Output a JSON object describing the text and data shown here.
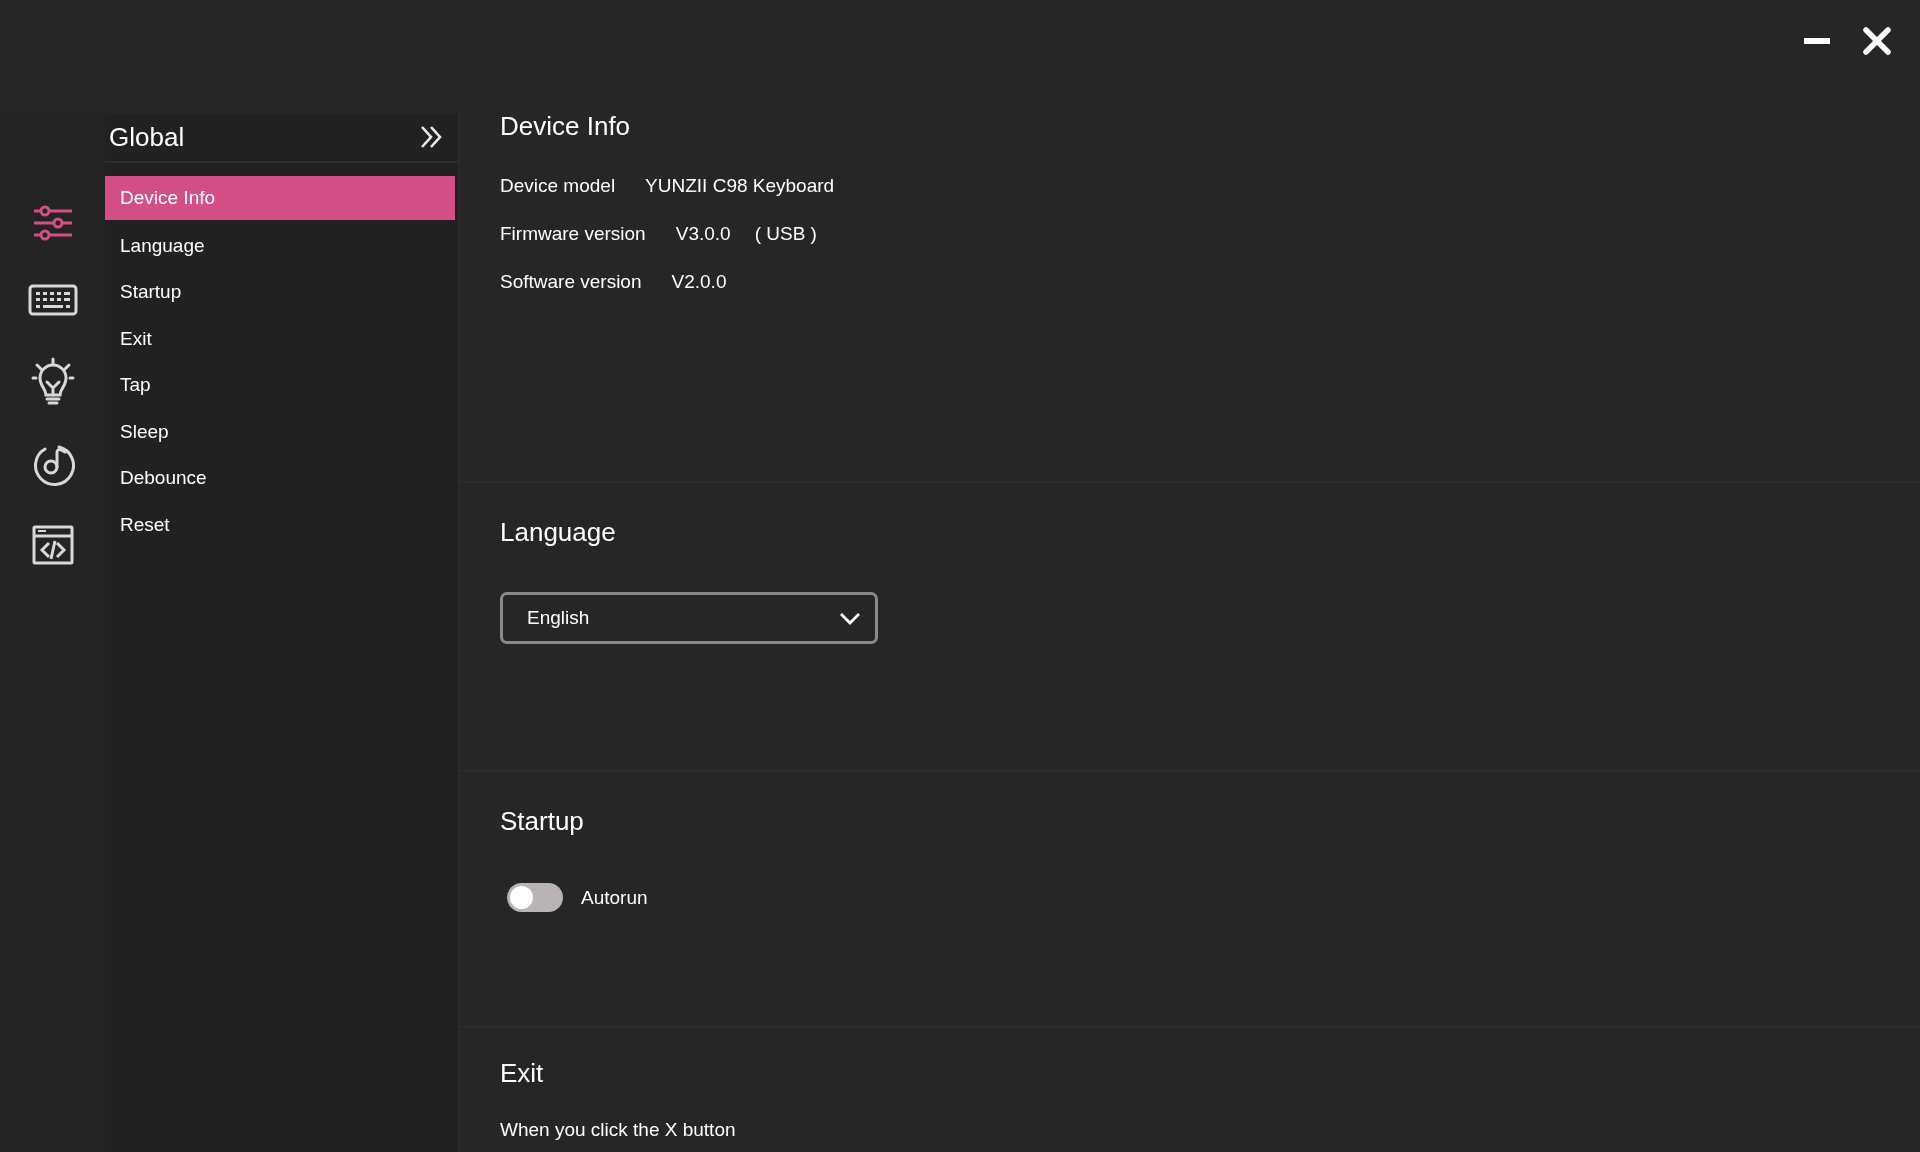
{
  "window_controls": [
    {
      "kind": "minimize"
    },
    {
      "kind": "close"
    }
  ],
  "rail": [
    {
      "kind": "sliders",
      "selected": true
    },
    {
      "kind": "keyboard",
      "selected": false
    },
    {
      "kind": "bulb",
      "selected": false
    },
    {
      "kind": "music",
      "selected": false
    },
    {
      "kind": "code",
      "selected": false
    }
  ],
  "sidebar": {
    "title": "Global",
    "items": [
      {
        "label": "Device Info",
        "selected": true
      },
      {
        "label": "Language",
        "selected": false
      },
      {
        "label": "Startup",
        "selected": false
      },
      {
        "label": "Exit",
        "selected": false
      },
      {
        "label": "Tap",
        "selected": false
      },
      {
        "label": "Sleep",
        "selected": false
      },
      {
        "label": "Debounce",
        "selected": false
      },
      {
        "label": "Reset",
        "selected": false
      }
    ]
  },
  "sections": [
    {
      "kind": "info",
      "title": "Device Info",
      "rows": [
        {
          "label": "Device model",
          "values": [
            "YUNZII C98 Keyboard"
          ]
        },
        {
          "label": "Firmware version",
          "values": [
            "V3.0.0",
            "( USB )"
          ]
        },
        {
          "label": "Software version",
          "values": [
            "V2.0.0"
          ]
        }
      ]
    },
    {
      "kind": "select",
      "title": "Language",
      "value": "English"
    },
    {
      "kind": "toggle",
      "title": "Startup",
      "label": "Autorun",
      "on": false
    },
    {
      "kind": "text",
      "title": "Exit",
      "text": "When you click the X button"
    }
  ]
}
